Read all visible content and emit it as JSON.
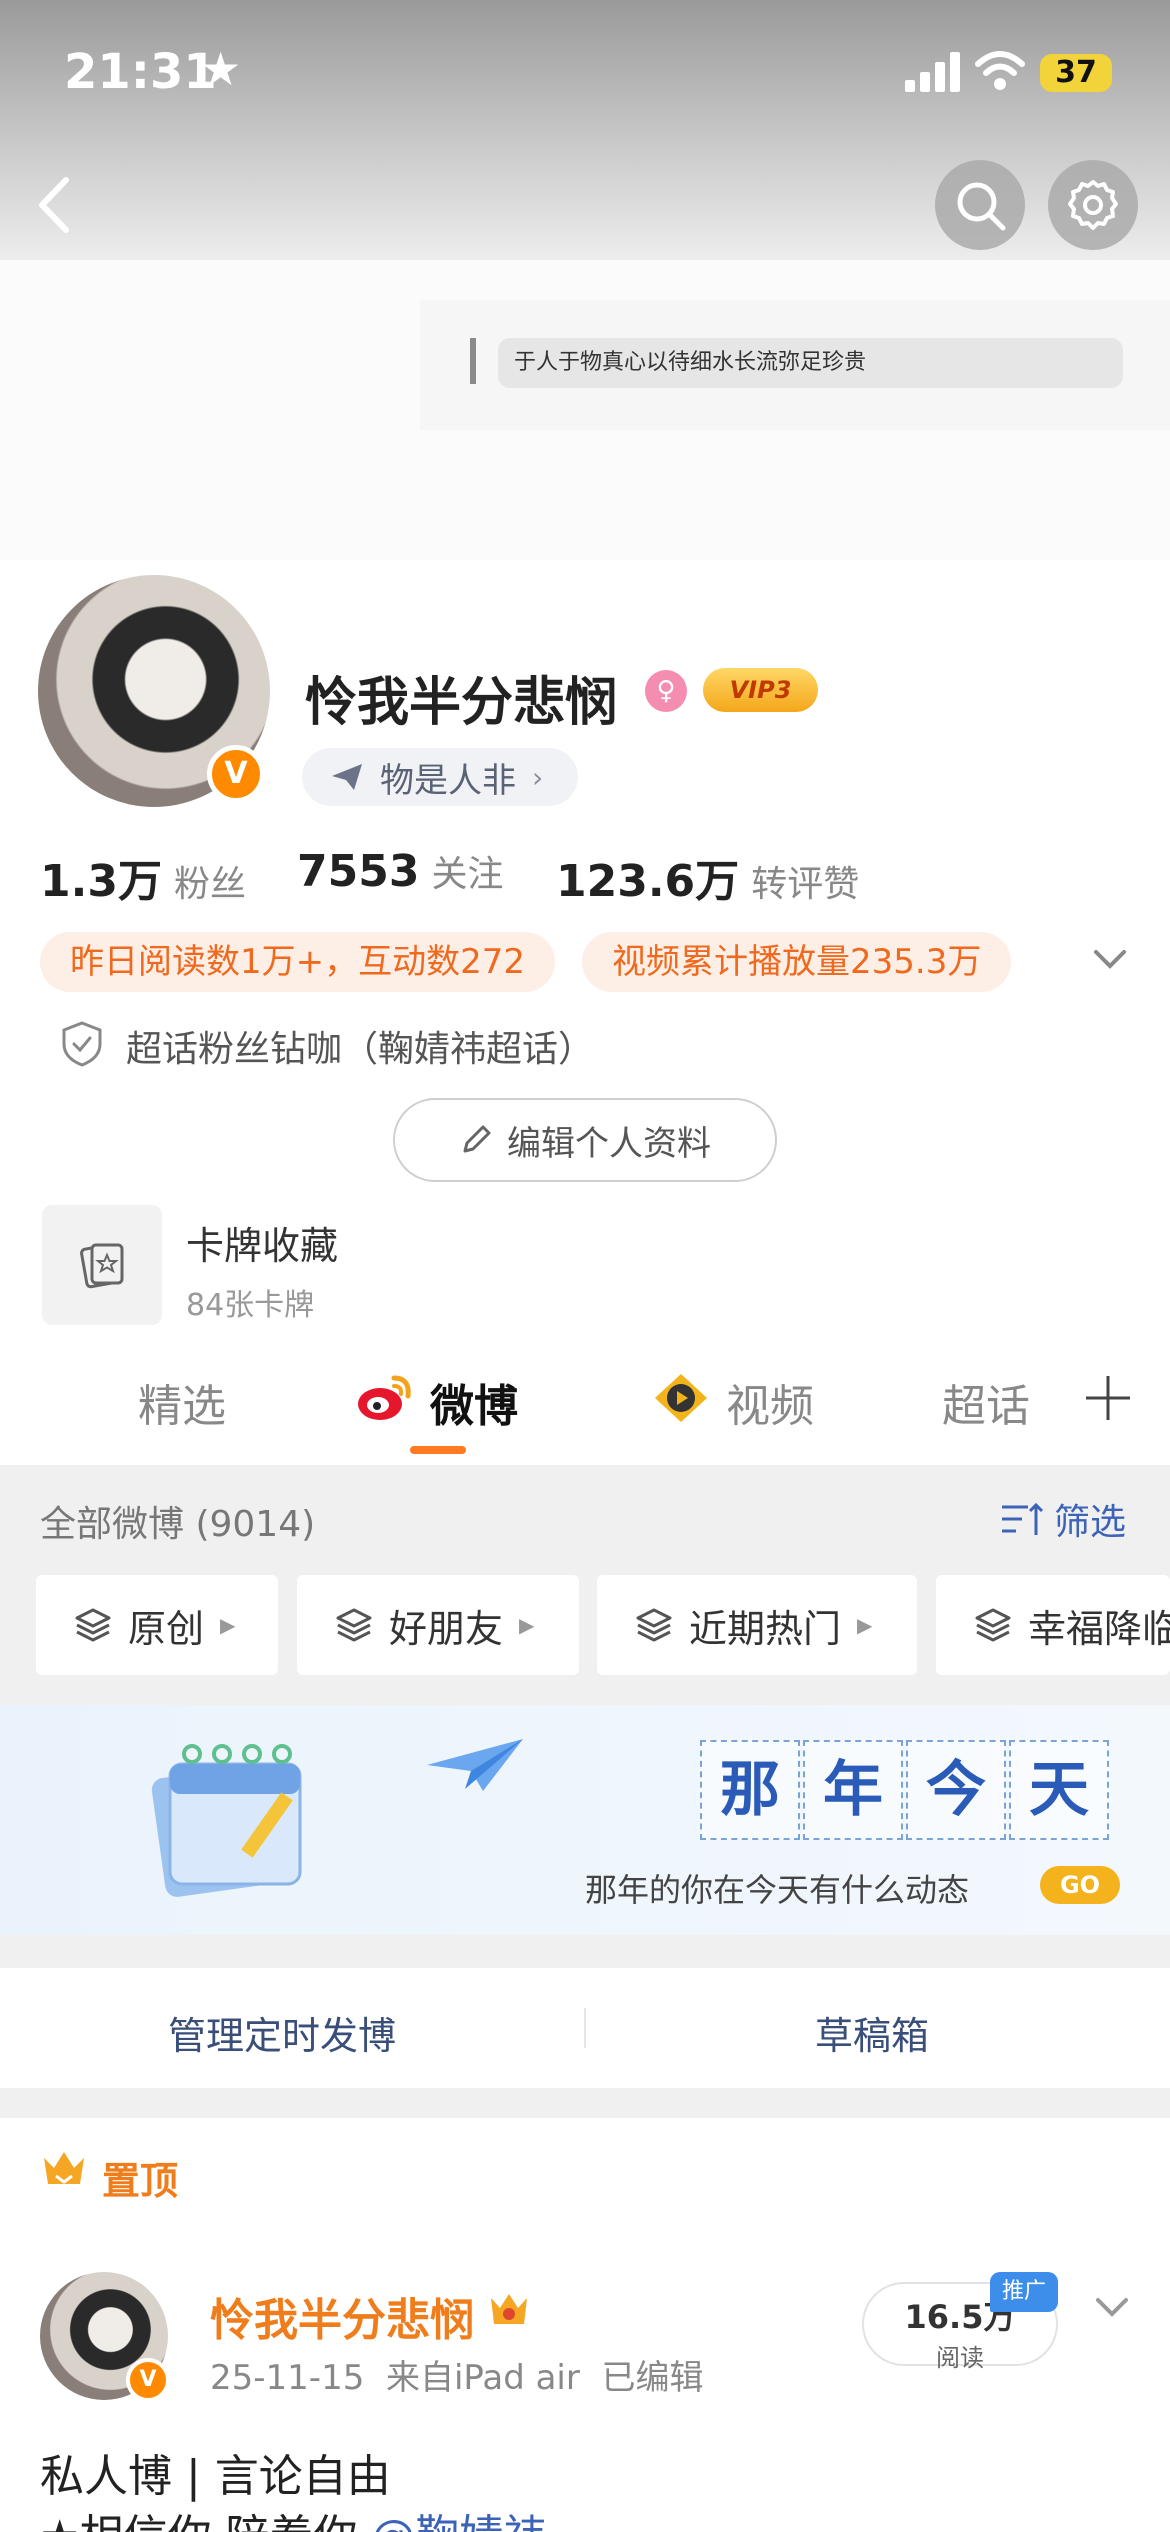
{
  "status_bar": {
    "time": "21:31",
    "battery": "37"
  },
  "signature": {
    "text": "于人于物真心以待细水长流弥足珍贵"
  },
  "profile": {
    "username": "怜我半分悲悯",
    "vip": "VIP3",
    "tag": "物是人非",
    "stats": [
      {
        "value": "1.3万",
        "label": "粉丝"
      },
      {
        "value": "7553",
        "label": "关注"
      },
      {
        "value": "123.6万",
        "label": "转评赞"
      }
    ],
    "badges": [
      "昨日阅读数1万+，互动数272",
      "视频累计播放量235.3万"
    ],
    "fan_title": "超话粉丝钻咖（鞠婧祎超话）",
    "edit_label": "编辑个人资料",
    "card_title": "卡牌收藏",
    "card_sub": "84张卡牌"
  },
  "tabs": [
    {
      "label": "精选",
      "active": false
    },
    {
      "label": "微博",
      "active": true
    },
    {
      "label": "视频",
      "active": false
    },
    {
      "label": "超话",
      "active": false
    }
  ],
  "feed": {
    "all_label": "全部微博 (9014)",
    "filter_label": "筛选",
    "chips": [
      "原创",
      "好朋友",
      "近期热门",
      "幸福降临"
    ],
    "banner_title": [
      "那",
      "年",
      "今",
      "天"
    ],
    "banner_sub": "那年的你在今天有什么动态",
    "banner_go": "GO",
    "manage": [
      "管理定时发博",
      "草稿箱"
    ],
    "pinned_label": "置顶"
  },
  "post": {
    "author": "怜我半分悲悯",
    "meta": "25-11-15  来自iPad air  已编辑",
    "reads": "16.5万",
    "reads_label": "阅读",
    "promo": "推广",
    "line1": "私人博 | 言论自由",
    "line2_prefix": "★相信你 陪着你 ",
    "line2_mention": "@鞠婧祎"
  }
}
